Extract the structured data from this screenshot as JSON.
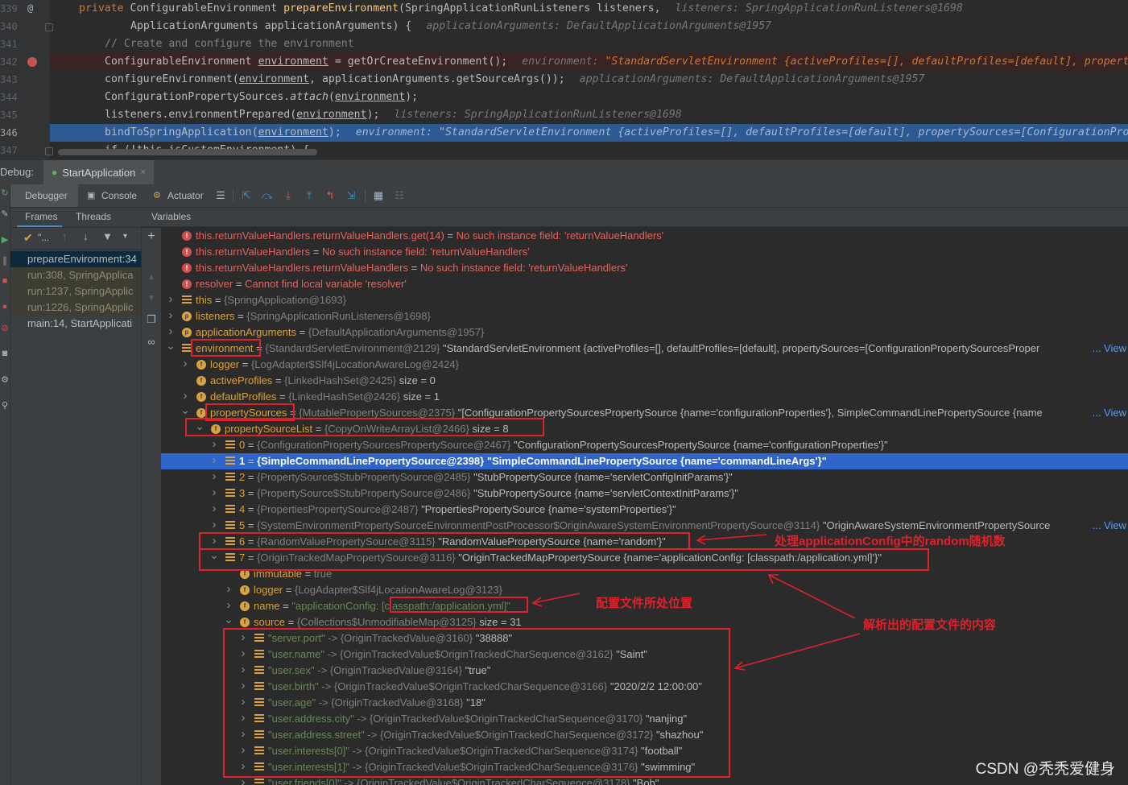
{
  "editor": {
    "lines": [
      {
        "no": "339",
        "gutter": "@",
        "segments": [
          {
            "t": "private ",
            "c": "kw"
          },
          {
            "t": "ConfigurableEnvironment "
          },
          {
            "t": "prepareEnvironment",
            "c": "fn"
          },
          {
            "t": "(SpringApplicationRunListeners listeners,"
          }
        ],
        "hint": "listeners: SpringApplicationRunListeners@1698",
        "indent": 98
      },
      {
        "no": "340",
        "segments": [
          {
            "t": "ApplicationArguments applicationArguments) {"
          }
        ],
        "hint": "applicationArguments: DefaultApplicationArguments@1957",
        "indent": 162
      },
      {
        "no": "341",
        "segments": [
          {
            "t": "// Create and configure the environment",
            "c": "cm"
          }
        ],
        "hint": "",
        "indent": 130
      },
      {
        "no": "342",
        "segments": [
          {
            "t": "ConfigurableEnvironment "
          },
          {
            "t": "environment",
            "c": "ul"
          },
          {
            "t": " = getOrCreateEnvironment();"
          }
        ],
        "hint_label": "environment: ",
        "hint_value": "\"StandardServletEnvironment {activeProfiles=[], defaultProfiles=[default], propertyS",
        "indent": 130,
        "breakpoint": true
      },
      {
        "no": "343",
        "segments": [
          {
            "t": "configureEnvironment("
          },
          {
            "t": "environment",
            "c": "ul"
          },
          {
            "t": ", applicationArguments.getSourceArgs());"
          }
        ],
        "hint": "applicationArguments: DefaultApplicationArguments@1957",
        "indent": 130
      },
      {
        "no": "344",
        "segments": [
          {
            "t": "ConfigurationPropertySources."
          },
          {
            "t": "attach",
            "c": "it"
          },
          {
            "t": "("
          },
          {
            "t": "environment",
            "c": "ul"
          },
          {
            "t": ");"
          }
        ],
        "hint": "",
        "indent": 130
      },
      {
        "no": "345",
        "segments": [
          {
            "t": "listeners.environmentPrepared("
          },
          {
            "t": "environment",
            "c": "ul"
          },
          {
            "t": ");"
          }
        ],
        "hint": "listeners: SpringApplicationRunListeners@1698",
        "indent": 130
      },
      {
        "no": "346",
        "segments": [
          {
            "t": "bindToSpringApplication("
          },
          {
            "t": "environment",
            "c": "ul"
          },
          {
            "t": ");"
          }
        ],
        "hint": "environment: \"StandardServletEnvironment {activeProfiles=[], defaultProfiles=[default], propertySources=[ConfigurationPrope",
        "indent": 130,
        "selected": true
      },
      {
        "no": "347",
        "segments": [
          {
            "t": "if (!this.isCustomEnvironment) {"
          }
        ],
        "hint": "",
        "indent": 130
      }
    ]
  },
  "debug": {
    "label": "Debug:",
    "session_tab": "StartApplication",
    "session_close": "×",
    "tabs": {
      "debugger": "Debugger",
      "console": "Console",
      "actuator": "Actuator"
    },
    "frames_tab": "Frames",
    "threads_tab": "Threads",
    "thread_selector": "\"...",
    "variables_title": "Variables",
    "frames": [
      {
        "text": "prepareEnvironment:34",
        "kind": "sel"
      },
      {
        "text": "run:308, SpringApplica",
        "kind": "lib"
      },
      {
        "text": "run:1237, SpringApplic",
        "kind": "lib"
      },
      {
        "text": "run:1226, SpringApplic",
        "kind": "lib"
      },
      {
        "text": "main:14, StartApplicati",
        "kind": "normal"
      }
    ]
  },
  "variables": [
    {
      "d": 0,
      "ch": "",
      "icon": "err",
      "name": "this.returnValueHandlers.returnValueHandlers.get(14)",
      "err": "No such instance field: 'returnValueHandlers'"
    },
    {
      "d": 0,
      "ch": "",
      "icon": "err",
      "name": "this.returnValueHandlers",
      "err": "No such instance field: 'returnValueHandlers'"
    },
    {
      "d": 0,
      "ch": "",
      "icon": "err",
      "name": "this.returnValueHandlers.returnValueHandlers",
      "err": "No such instance field: 'returnValueHandlers'"
    },
    {
      "d": 0,
      "ch": "",
      "icon": "err",
      "name": "resolver",
      "err": "Cannot find local variable 'resolver'"
    },
    {
      "d": 0,
      "ch": ">",
      "icon": "list",
      "name": "this",
      "ref": "{SpringApplication@1693}"
    },
    {
      "d": 0,
      "ch": ">",
      "icon": "p",
      "name": "listeners",
      "ref": "{SpringApplicationRunListeners@1698}"
    },
    {
      "d": 0,
      "ch": ">",
      "icon": "p",
      "name": "applicationArguments",
      "ref": "{DefaultApplicationArguments@1957}"
    },
    {
      "d": 0,
      "ch": "v",
      "icon": "list",
      "name": "environment",
      "ref": "{StandardServletEnvironment@2129}",
      "val": "\"StandardServletEnvironment {activeProfiles=[], defaultProfiles=[default], propertySources=[ConfigurationPropertySourcesProper",
      "more": "... View"
    },
    {
      "d": 1,
      "ch": ">",
      "icon": "f",
      "name": "logger",
      "ref": "{LogAdapter$Slf4jLocationAwareLog@2424}"
    },
    {
      "d": 1,
      "ch": "",
      "icon": "f",
      "name": "activeProfiles",
      "ref": "{LinkedHashSet@2425}",
      "val": " size = 0"
    },
    {
      "d": 1,
      "ch": ">",
      "icon": "f",
      "name": "defaultProfiles",
      "ref": "{LinkedHashSet@2426}",
      "val": " size = 1"
    },
    {
      "d": 1,
      "ch": "v",
      "icon": "f",
      "name": "propertySources",
      "ref": "{MutablePropertySources@2375}",
      "val": "\"[ConfigurationPropertySourcesPropertySource {name='configurationProperties'}, SimpleCommandLinePropertySource {name",
      "more": "... View"
    },
    {
      "d": 2,
      "ch": "v",
      "icon": "f",
      "name": "propertySourceList",
      "ref": "{CopyOnWriteArrayList@2466}",
      "val": " size = 8"
    },
    {
      "d": 3,
      "ch": ">",
      "icon": "list",
      "name": "0",
      "ref": "{ConfigurationPropertySourcesPropertySource@2467}",
      "val": "\"ConfigurationPropertySourcesPropertySource {name='configurationProperties'}\""
    },
    {
      "d": 3,
      "ch": ">",
      "icon": "list",
      "name": "1",
      "ref": "{SimpleCommandLinePropertySource@2398}",
      "val": "\"SimpleCommandLinePropertySource {name='commandLineArgs'}\"",
      "sel": true
    },
    {
      "d": 3,
      "ch": ">",
      "icon": "list",
      "name": "2",
      "ref": "{PropertySource$StubPropertySource@2485}",
      "val": "\"StubPropertySource {name='servletConfigInitParams'}\""
    },
    {
      "d": 3,
      "ch": ">",
      "icon": "list",
      "name": "3",
      "ref": "{PropertySource$StubPropertySource@2486}",
      "val": "\"StubPropertySource {name='servletContextInitParams'}\""
    },
    {
      "d": 3,
      "ch": ">",
      "icon": "list",
      "name": "4",
      "ref": "{PropertiesPropertySource@2487}",
      "val": "\"PropertiesPropertySource {name='systemProperties'}\""
    },
    {
      "d": 3,
      "ch": ">",
      "icon": "list",
      "name": "5",
      "ref": "{SystemEnvironmentPropertySourceEnvironmentPostProcessor$OriginAwareSystemEnvironmentPropertySource@3114}",
      "val": "\"OriginAwareSystemEnvironmentPropertySource",
      "more": "... View"
    },
    {
      "d": 3,
      "ch": ">",
      "icon": "list",
      "name": "6",
      "ref": "{RandomValuePropertySource@3115}",
      "val": "\"RandomValuePropertySource {name='random'}\""
    },
    {
      "d": 3,
      "ch": "v",
      "icon": "list",
      "name": "7",
      "ref": "{OriginTrackedMapPropertySource@3116}",
      "val": "\"OriginTrackedMapPropertySource {name='applicationConfig: [classpath:/application.yml]'}\""
    },
    {
      "d": 4,
      "ch": "",
      "icon": "f",
      "name": "immutable",
      "ref": "true"
    },
    {
      "d": 4,
      "ch": ">",
      "icon": "f",
      "name": "logger",
      "ref": "{LogAdapter$Slf4jLocationAwareLog@3123}"
    },
    {
      "d": 4,
      "ch": ">",
      "icon": "f",
      "name": "name",
      "ref_pre": "\"applicationConfig: ",
      "ref_boxed": "[classpath:/application.yml]",
      "ref_post": "\""
    },
    {
      "d": 4,
      "ch": "v",
      "icon": "f",
      "name": "source",
      "ref": "{Collections$UnmodifiableMap@3125}",
      "val": " size = 31"
    },
    {
      "d": 5,
      "ch": ">",
      "icon": "list",
      "name": "\"server.port\"",
      "key": true,
      "ref": "-> {OriginTrackedValue@3160}",
      "val": "\"38888\""
    },
    {
      "d": 5,
      "ch": ">",
      "icon": "list",
      "name": "\"user.name\"",
      "key": true,
      "ref": "-> {OriginTrackedValue$OriginTrackedCharSequence@3162}",
      "val": "\"Saint\""
    },
    {
      "d": 5,
      "ch": ">",
      "icon": "list",
      "name": "\"user.sex\"",
      "key": true,
      "ref": "-> {OriginTrackedValue@3164}",
      "val": "\"true\""
    },
    {
      "d": 5,
      "ch": ">",
      "icon": "list",
      "name": "\"user.birth\"",
      "key": true,
      "ref": "-> {OriginTrackedValue$OriginTrackedCharSequence@3166}",
      "val": "\"2020/2/2 12:00:00\""
    },
    {
      "d": 5,
      "ch": ">",
      "icon": "list",
      "name": "\"user.age\"",
      "key": true,
      "ref": "-> {OriginTrackedValue@3168}",
      "val": "\"18\""
    },
    {
      "d": 5,
      "ch": ">",
      "icon": "list",
      "name": "\"user.address.city\"",
      "key": true,
      "ref": "-> {OriginTrackedValue$OriginTrackedCharSequence@3170}",
      "val": "\"nanjing\""
    },
    {
      "d": 5,
      "ch": ">",
      "icon": "list",
      "name": "\"user.address.street\"",
      "key": true,
      "ref": "-> {OriginTrackedValue$OriginTrackedCharSequence@3172}",
      "val": "\"shazhou\""
    },
    {
      "d": 5,
      "ch": ">",
      "icon": "list",
      "name": "\"user.interests[0]\"",
      "key": true,
      "ref": "-> {OriginTrackedValue$OriginTrackedCharSequence@3174}",
      "val": "\"football\""
    },
    {
      "d": 5,
      "ch": ">",
      "icon": "list",
      "name": "\"user.interests[1]\"",
      "key": true,
      "ref": "-> {OriginTrackedValue$OriginTrackedCharSequence@3176}",
      "val": "\"swimming\""
    },
    {
      "d": 5,
      "ch": ">",
      "icon": "list",
      "name": "\"user.friends[0]\"",
      "key": true,
      "ref": "-> {OriginTrackedValue$OriginTrackedCharSequence@3178}",
      "val": "\"Bob\""
    }
  ],
  "annotations": {
    "random_note": "处理applicationConfig中的random随机数",
    "location_note": "配置文件所处位置",
    "content_note": "解析出的配置文件的内容"
  },
  "watermark": "CSDN @秃秃爱健身",
  "colors": {
    "annotation": "#e0212b",
    "selection": "#2f65ca",
    "error": "#e0665c"
  }
}
